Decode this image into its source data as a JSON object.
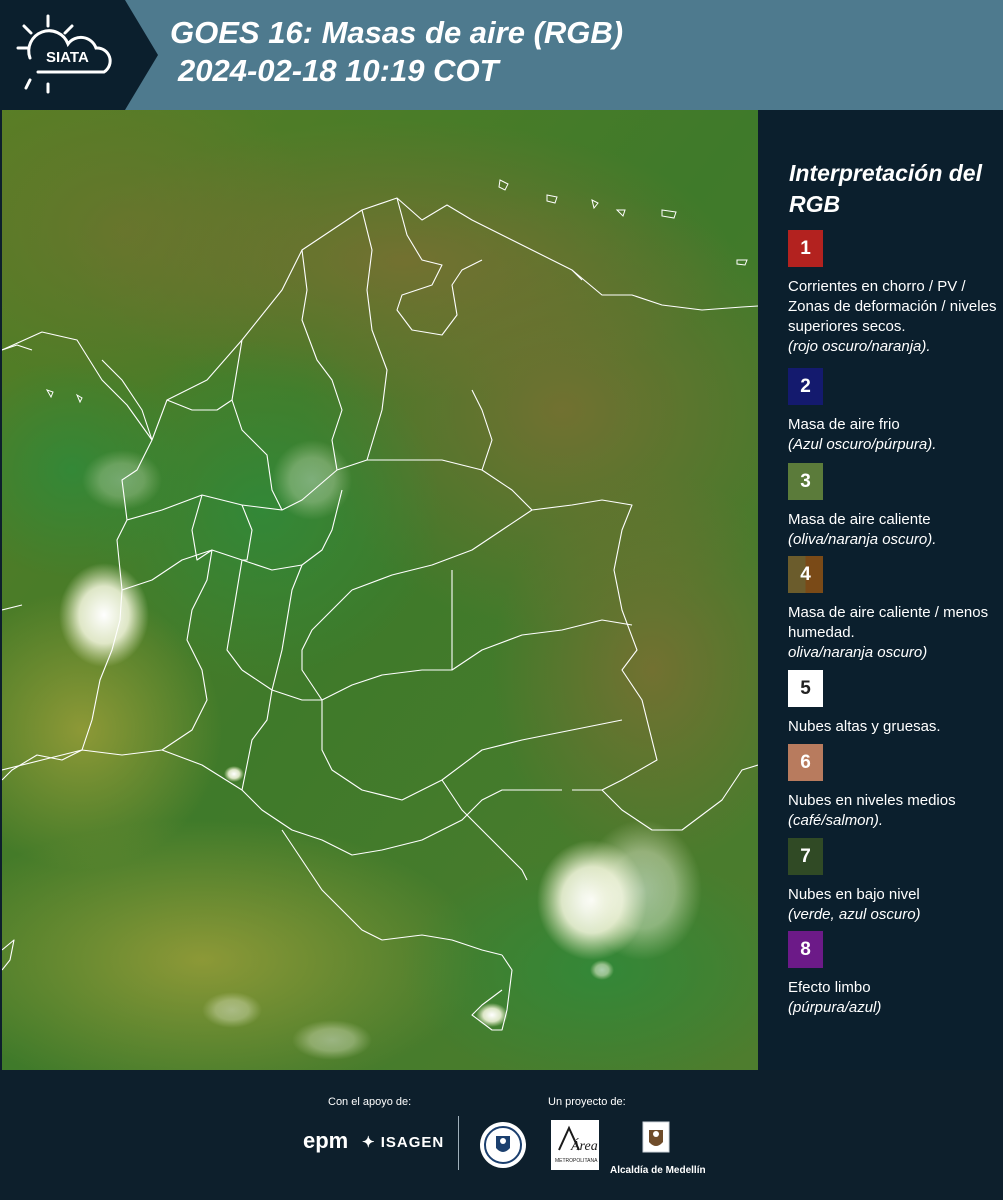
{
  "header": {
    "logo_text": "SIATA",
    "title_line1": "GOES 16: Masas de aire (RGB)",
    "title_line2": "2024-02-18 10:19 COT"
  },
  "legend": {
    "title": "Interpretación del RGB",
    "items": [
      {
        "number": "1",
        "color": "#b3221f",
        "label": "Corrientes en chorro / PV / Zonas de deformación / niveles superiores secos.",
        "note": "(rojo oscuro/naranja)."
      },
      {
        "number": "2",
        "color": "#141a6e",
        "label": "Masa de aire frio",
        "note": "(Azul oscuro/púrpura)."
      },
      {
        "number": "3",
        "color": "#5b7b3a",
        "label": "Masa de aire caliente",
        "note": "(oliva/naranja oscuro)."
      },
      {
        "number": "4",
        "color": "#6b5c2c",
        "color2": "#7a4a17",
        "label": "Masa de aire caliente / menos humedad.",
        "note": "oliva/naranja oscuro)"
      },
      {
        "number": "5",
        "color": "#ffffff",
        "label": "Nubes altas y gruesas.",
        "note": ""
      },
      {
        "number": "6",
        "color": "#b87b5e",
        "label": "Nubes en niveles medios",
        "note": "(café/salmon)."
      },
      {
        "number": "7",
        "color": "#304a25",
        "label": "Nubes en bajo nivel",
        "note": "(verde, azul oscuro)"
      },
      {
        "number": "8",
        "color": "#6c1a88",
        "label": "Efecto limbo",
        "note": "(púrpura/azul)"
      }
    ]
  },
  "footer": {
    "support_label": "Con el apoyo de:",
    "project_label": "Un proyecto de:",
    "sponsor1": "epm",
    "sponsor2": "ISAGEN",
    "partner_area": "Área",
    "partner_area_sub": "METROPOLITANA",
    "partner_alcaldia": "Alcaldía de Medellín"
  }
}
